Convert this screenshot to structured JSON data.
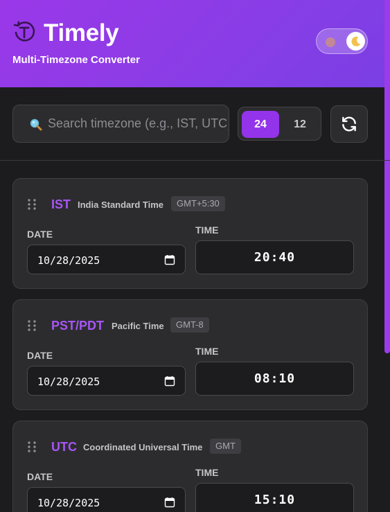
{
  "app": {
    "title": "Timely",
    "subtitle": "Multi-Timezone Converter"
  },
  "theme_toggle": {
    "mode": "dark",
    "icons": [
      "sun-icon",
      "moon-icon"
    ]
  },
  "search": {
    "value": "",
    "placeholder": "Search timezone (e.g., IST, UTC)"
  },
  "format": {
    "options": [
      "24",
      "12"
    ],
    "selected": "24"
  },
  "colors": {
    "accent": "#9333ea",
    "tz_code": "#a855f7",
    "header_gradient_start": "#9a38e8",
    "header_gradient_end": "#7a3fe4",
    "background": "#1c1c1e",
    "card": "#2c2c2e"
  },
  "labels": {
    "date": "DATE",
    "time": "TIME"
  },
  "timezones": [
    {
      "code": "IST",
      "name": "India Standard Time",
      "offset": "GMT+5:30",
      "date": "10/28/2025",
      "time": "20:40"
    },
    {
      "code": "PST/PDT",
      "name": "Pacific Time",
      "offset": "GMT-8",
      "date": "10/28/2025",
      "time": "08:10"
    },
    {
      "code": "UTC",
      "name": "Coordinated Universal Time",
      "offset": "GMT",
      "date": "10/28/2025",
      "time": "15:10"
    }
  ]
}
